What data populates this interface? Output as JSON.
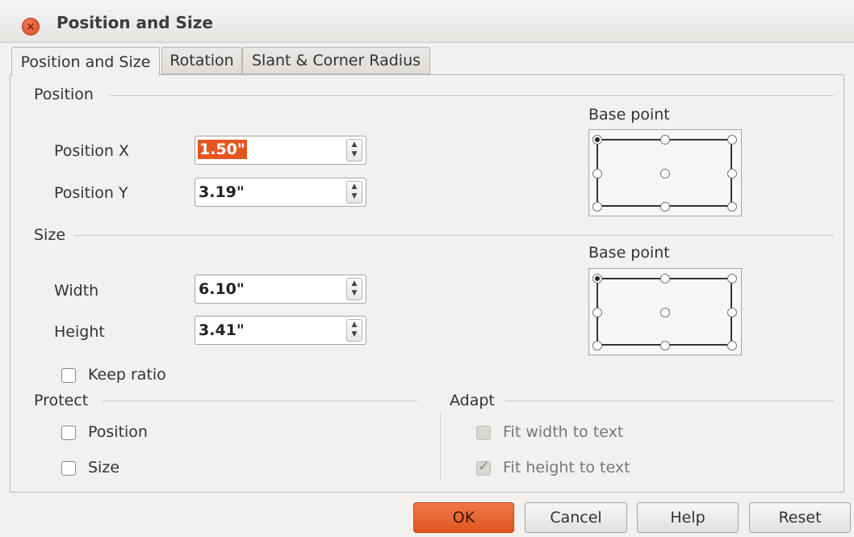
{
  "window": {
    "title": "Position and Size"
  },
  "tabs": [
    {
      "label": "Position and Size",
      "active": true
    },
    {
      "label": "Rotation",
      "active": false
    },
    {
      "label": "Slant & Corner Radius",
      "active": false
    }
  ],
  "position": {
    "heading": "Position",
    "x_label": "Position X",
    "x_value": "1.50\"",
    "y_label": "Position Y",
    "y_value": "3.19\"",
    "base_point_label": "Base point"
  },
  "size": {
    "heading": "Size",
    "width_label": "Width",
    "width_value": "6.10\"",
    "height_label": "Height",
    "height_value": "3.41\"",
    "base_point_label": "Base point",
    "keep_ratio_label": "Keep ratio",
    "keep_ratio_checked": false
  },
  "protect": {
    "heading": "Protect",
    "position_label": "Position",
    "size_label": "Size"
  },
  "adapt": {
    "heading": "Adapt",
    "fit_width_label": "Fit width to text",
    "fit_height_label": "Fit height to text"
  },
  "buttons": {
    "ok": "OK",
    "cancel": "Cancel",
    "help": "Help",
    "reset": "Reset"
  },
  "colors": {
    "accent": "#e5561e",
    "ok_button": "#e9672f",
    "close_button": "#e45f3c"
  }
}
